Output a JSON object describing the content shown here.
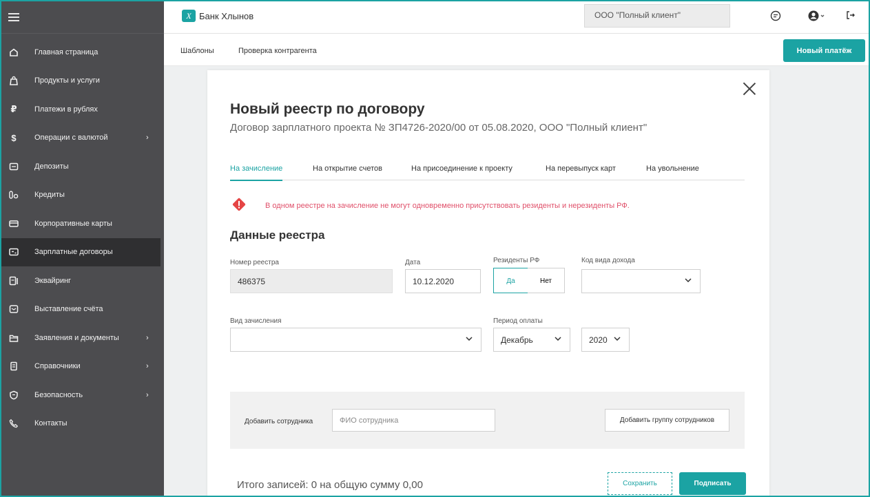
{
  "colors": {
    "accent": "#1ba3a3",
    "sidebar_bg": "#4c4c4f",
    "warning": "#e0506a"
  },
  "sidebar": {
    "items": [
      {
        "label": "Главная страница",
        "icon": "home-icon"
      },
      {
        "label": "Продукты и услуги",
        "icon": "bag-icon"
      },
      {
        "label": "Платежи в рублях",
        "icon": "ruble-icon"
      },
      {
        "label": "Операции с валютой",
        "icon": "dollar-icon",
        "chevron": "›"
      },
      {
        "label": "Депозиты",
        "icon": "deposit-icon"
      },
      {
        "label": "Кредиты",
        "icon": "credit-icon"
      },
      {
        "label": "Корпоративные карты",
        "icon": "card-icon"
      },
      {
        "label": "Зарплатные договоры",
        "icon": "salary-icon",
        "active": true
      },
      {
        "label": "Эквайринг",
        "icon": "terminal-icon"
      },
      {
        "label": "Выставление счёта",
        "icon": "invoice-icon"
      },
      {
        "label": "Заявления и документы",
        "icon": "folder-icon",
        "chevron": "›"
      },
      {
        "label": "Справочники",
        "icon": "book-icon",
        "chevron": "›"
      },
      {
        "label": "Безопасность",
        "icon": "shield-icon",
        "chevron": "›"
      },
      {
        "label": "Контакты",
        "icon": "phone-icon"
      }
    ]
  },
  "header": {
    "bank_name": "Банк Хлынов",
    "client": "ООО \"Полный клиент\""
  },
  "subnav": {
    "templates": "Шаблоны",
    "check_counterparty": "Проверка контрагента",
    "new_payment": "Новый платёж"
  },
  "modal": {
    "title": "Новый реестр по договору",
    "subtitle": "Договор зарплатного проекта № ЗП4726-2020/00 от 05.08.2020, ООО \"Полный клиент\"",
    "tabs": [
      "На зачисление",
      "На открытие счетов",
      "На присоединение к проекту",
      "На перевыпуск карт",
      "На увольнение"
    ],
    "warning": "В одном реестре на зачисление не могут одновременно присутствовать резиденты и нерезиденты РФ.",
    "section_title": "Данные реестра",
    "fields": {
      "registry_number_label": "Номер реестра",
      "registry_number": "486375",
      "date_label": "Дата",
      "date": "10.12.2020",
      "residents_label": "Резиденты РФ",
      "residents_yes": "Да",
      "residents_no": "Нет",
      "income_code_label": "Код вида дохода",
      "income_code": "",
      "credit_type_label": "Вид зачисления",
      "credit_type": "",
      "pay_period_label": "Период оплаты",
      "pay_month": "Декабрь",
      "pay_year": "2020"
    },
    "employees": {
      "add_label": "Добавить сотрудника",
      "placeholder": "ФИО сотрудника",
      "add_group": "Добавить группу сотрудников"
    },
    "total": "Итого записей: 0 на общую сумму 0,00",
    "save": "Сохранить",
    "sign": "Подписать"
  }
}
